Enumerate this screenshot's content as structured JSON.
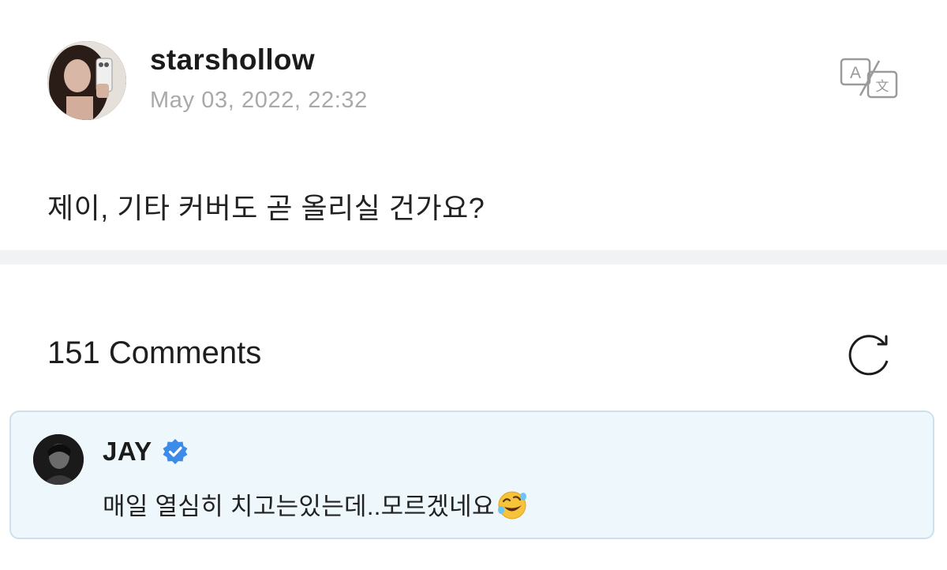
{
  "post": {
    "username": "starshollow",
    "timestamp": "May 03, 2022, 22:32",
    "body": "제이, 기타 커버도 곧 올리실 건가요?",
    "translate_icon": "translate-icon"
  },
  "comments": {
    "count_label": "151 Comments",
    "refresh_icon": "refresh-icon",
    "items": [
      {
        "author": "JAY",
        "verified": true,
        "text": "매일 열심히 치고는있는데..모르겠네요",
        "emoji": "rolling-on-floor-laughing-emoji"
      }
    ]
  },
  "colors": {
    "card_background": "#eef7fc",
    "card_border": "#cfe0ea",
    "verified_blue": "#3d8be8",
    "timestamp_gray": "#a9a9a9",
    "divider": "#f1f2f4"
  }
}
